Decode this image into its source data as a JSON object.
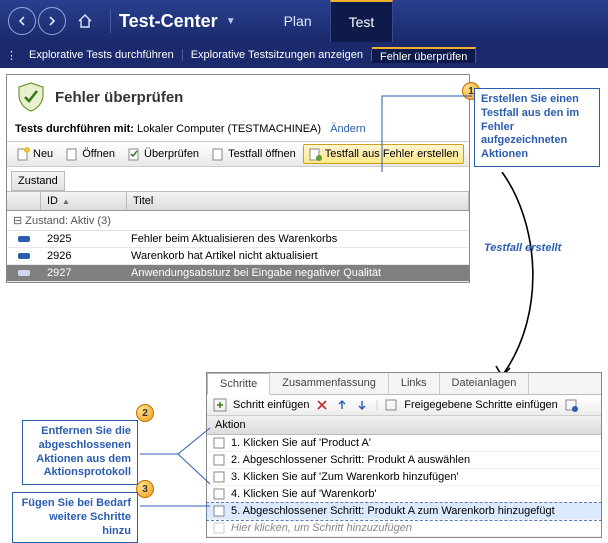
{
  "header": {
    "app_title": "Test-Center",
    "tabs": {
      "plan": "Plan",
      "test": "Test"
    }
  },
  "subnav": {
    "item1": "Explorative Tests durchführen",
    "item2": "Explorative Testsitzungen anzeigen",
    "item3": "Fehler überprüfen"
  },
  "panel": {
    "title": "Fehler überprüfen",
    "run_label": "Tests durchführen mit:",
    "run_value": "Lokaler Computer (TESTMACHINEA)",
    "change": "Ändern"
  },
  "toolbar": {
    "neu": "Neu",
    "oeffnen": "Öffnen",
    "ueberpruefen": "Überprüfen",
    "testfall_oeffnen": "Testfall öffnen",
    "testfall_erstellen": "Testfall aus Fehler erstellen"
  },
  "grid": {
    "group_hdr": "Zustand",
    "cols": {
      "id": "ID",
      "titel": "Titel"
    },
    "group_row": "Zustand: Aktiv (3)",
    "rows": [
      {
        "id": "2925",
        "titel": "Fehler beim Aktualisieren des Warenkorbs"
      },
      {
        "id": "2926",
        "titel": "Warenkorb hat Artikel nicht aktualisiert"
      },
      {
        "id": "2927",
        "titel": "Anwendungsabsturz bei Eingabe negativer Qualität"
      }
    ]
  },
  "callouts": {
    "c1": "Erstellen Sie einen Testfall aus den im Fehler aufgezeichneten Aktionen",
    "c2": "Entfernen Sie die abgeschlossenen Aktionen aus dem Aktionsprotokoll",
    "c3": "Fügen Sie bei Bedarf weitere Schritte hinzu",
    "arrow": "Testfall erstellt"
  },
  "detail": {
    "tabs": {
      "schritte": "Schritte",
      "zusammen": "Zusammenfassung",
      "links": "Links",
      "datei": "Dateianlagen"
    },
    "toolbar": {
      "insert": "Schritt einfügen",
      "shared": "Freigegebene Schritte einfügen"
    },
    "action_hdr": "Aktion",
    "steps": [
      "1. Klicken Sie auf 'Product A'",
      "2. Abgeschlossener Schritt: Produkt A auswählen",
      "3. Klicken Sie auf 'Zum Warenkorb hinzufügen'",
      "4. Klicken Sie auf 'Warenkorb'",
      "5. Abgeschlossener Schritt: Produkt A zum Warenkorb hinzugefügt"
    ],
    "ghost": "Hier klicken, um Schritt hinzuzufügen"
  }
}
